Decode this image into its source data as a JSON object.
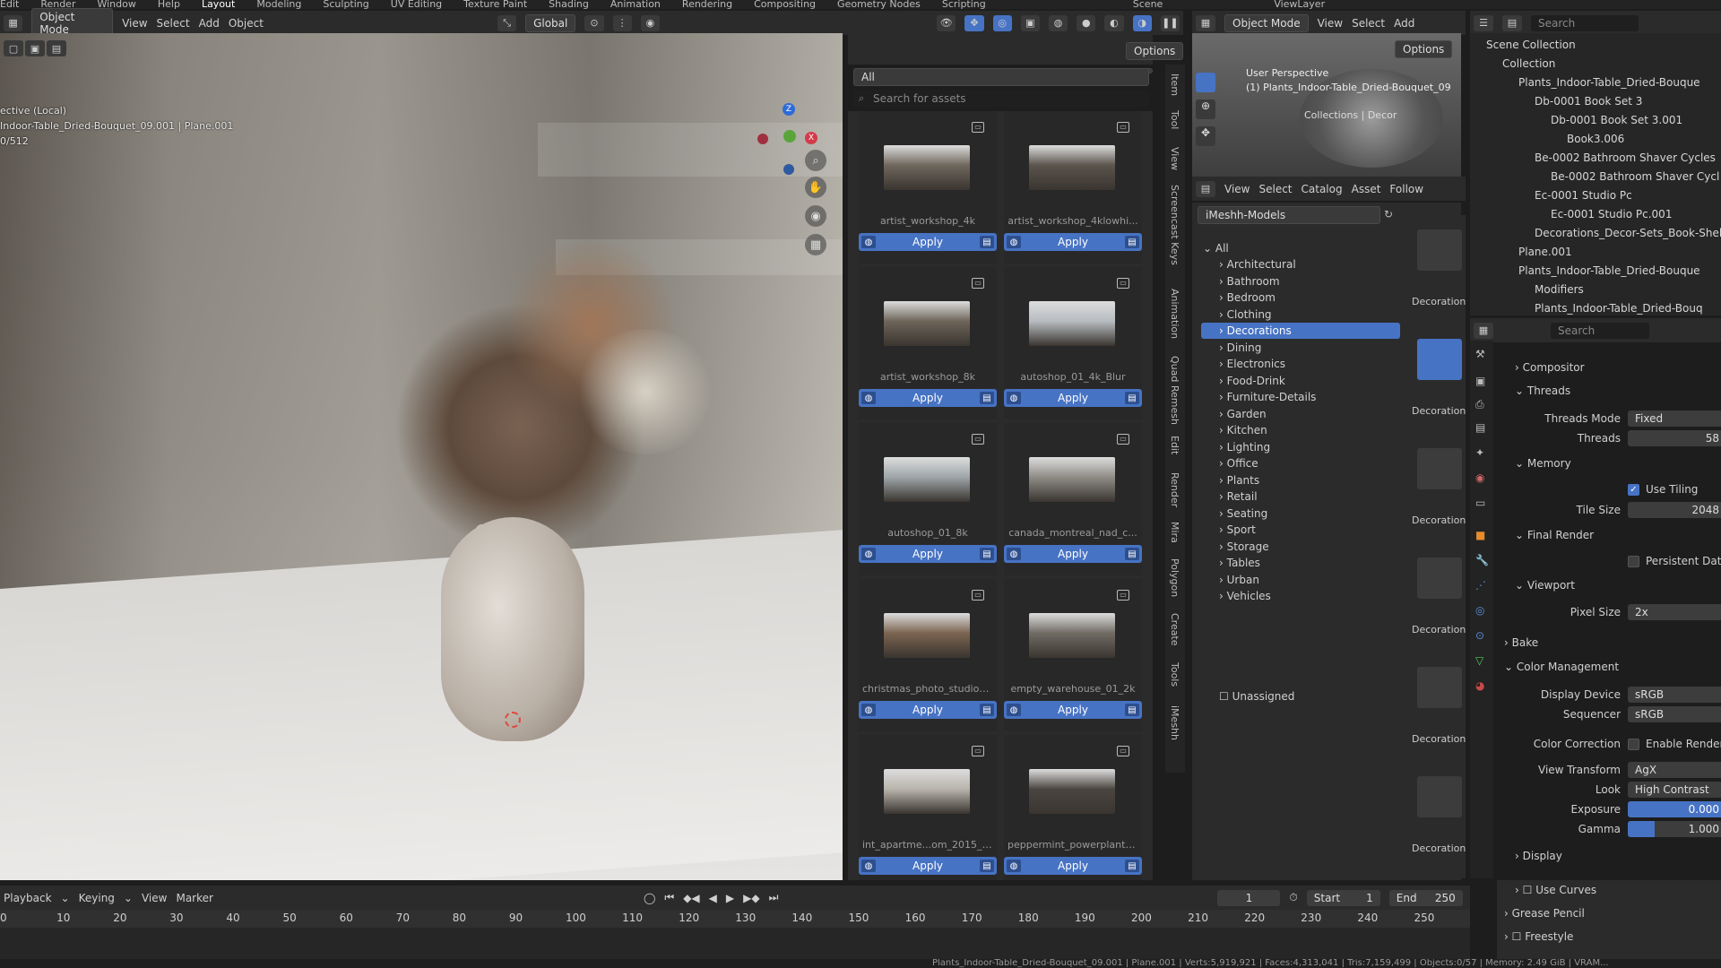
{
  "top_tabs": [
    "Edit",
    "Render",
    "Window",
    "Help",
    "Layout",
    "Modeling",
    "Sculpting",
    "UV Editing",
    "Texture Paint",
    "Shading",
    "Animation",
    "Rendering",
    "Compositing",
    "Geometry Nodes",
    "Scripting"
  ],
  "top_active": "Layout",
  "scene_label": "Scene",
  "viewlayer_label": "ViewLayer",
  "viewport_header": {
    "mode": "Object Mode",
    "menus": [
      "View",
      "Select",
      "Add",
      "Object"
    ],
    "orientation": "Global",
    "options": "Options"
  },
  "viewport_overlay": {
    "line1": "ective (Local)",
    "line2": "Indoor-Table_Dried-Bouquet_09.001 | Plane.001",
    "line3": "0/512"
  },
  "asset_browser": {
    "filter": "All",
    "search_placeholder": "Search for assets",
    "apply_label": "Apply",
    "items": [
      {
        "name": "artist_workshop_4k"
      },
      {
        "name": "artist_workshop_4klowhi..."
      },
      {
        "name": "artist_workshop_8k"
      },
      {
        "name": "autoshop_01_4k_Blur"
      },
      {
        "name": "autoshop_01_8k"
      },
      {
        "name": "canada_montreal_nad_c..."
      },
      {
        "name": "christmas_photo_studio_..."
      },
      {
        "name": "empty_warehouse_01_2k"
      },
      {
        "name": "int_apartme...om_2015_1k"
      },
      {
        "name": "peppermint_powerplant_..."
      }
    ],
    "thumb_colors": [
      "#6f675d",
      "#5a544c",
      "#6e655a",
      "#b7bcc0",
      "#9ea5a8",
      "#8f8c86",
      "#7b6450",
      "#706b63",
      "#b8b4ac",
      "#4a4540"
    ]
  },
  "vertical_tabs": [
    "Item",
    "Tool",
    "View",
    "Screencast Keys",
    "Animation",
    "Quad Remesh",
    "Edit",
    "Render",
    "Mira",
    "Polygon",
    "Create",
    "Tools",
    "iMeshh"
  ],
  "mini_viewport": {
    "mode": "Object Mode",
    "menus": [
      "View",
      "Select",
      "Add"
    ],
    "options": "Options",
    "title": "User Perspective",
    "subtitle": "(1) Plants_Indoor-Table_Dried-Bouquet_09",
    "collections_label": "Collections | Decor"
  },
  "catalog": {
    "menus": [
      "View",
      "Select",
      "Catalog",
      "Asset",
      "Follow"
    ],
    "library": "iMeshh-Models",
    "root": "All",
    "items": [
      "Architectural",
      "Bathroom",
      "Bedroom",
      "Clothing",
      "Decorations",
      "Dining",
      "Electronics",
      "Food-Drink",
      "Furniture-Details",
      "Garden",
      "Kitchen",
      "Lighting",
      "Office",
      "Plants",
      "Retail",
      "Seating",
      "Sport",
      "Storage",
      "Tables",
      "Urban",
      "Vehicles"
    ],
    "unassigned": "Unassigned",
    "selected": "Decorations",
    "thumb_label": "Decoration"
  },
  "outliner": {
    "search_placeholder": "Search",
    "items": [
      {
        "label": "Scene Collection",
        "indent": 0
      },
      {
        "label": "Collection",
        "indent": 1
      },
      {
        "label": "Plants_Indoor-Table_Dried-Bouque",
        "indent": 2
      },
      {
        "label": "Db-0001 Book Set 3",
        "indent": 3
      },
      {
        "label": "Db-0001 Book Set 3.001",
        "indent": 4
      },
      {
        "label": "Book3.006",
        "indent": 5
      },
      {
        "label": "Be-0002 Bathroom Shaver Cycles",
        "indent": 3
      },
      {
        "label": "Be-0002 Bathroom Shaver Cycl",
        "indent": 4
      },
      {
        "label": "Ec-0001 Studio Pc",
        "indent": 3
      },
      {
        "label": "Ec-0001 Studio Pc.001",
        "indent": 4
      },
      {
        "label": "Decorations_Decor-Sets_Book-Shel",
        "indent": 3
      },
      {
        "label": "Plane.001",
        "indent": 2
      },
      {
        "label": "Plants_Indoor-Table_Dried-Bouque",
        "indent": 2
      },
      {
        "label": "Modifiers",
        "indent": 3
      },
      {
        "label": "Plants_Indoor-Table_Dried-Bouq",
        "indent": 3
      }
    ]
  },
  "properties": {
    "search_placeholder": "Search",
    "compositor": "Compositor",
    "threads": "Threads",
    "threads_mode_label": "Threads Mode",
    "threads_mode": "Fixed",
    "threads_label": "Threads",
    "threads_value": "58",
    "memory": "Memory",
    "use_tiling": "Use Tiling",
    "tile_size_label": "Tile Size",
    "tile_size": "2048",
    "final_render": "Final Render",
    "persistent_data": "Persistent Data",
    "viewport": "Viewport",
    "pixel_size_label": "Pixel Size",
    "pixel_size": "2x",
    "bake": "Bake",
    "color_management": "Color Management",
    "display_device_label": "Display Device",
    "display_device": "sRGB",
    "sequencer_label": "Sequencer",
    "sequencer": "sRGB",
    "color_correction_label": "Color Correction",
    "enable_render": "Enable Render Ra",
    "view_transform_label": "View Transform",
    "view_transform": "AgX",
    "look_label": "Look",
    "look": "High Contrast",
    "exposure_label": "Exposure",
    "exposure": "0.000",
    "gamma_label": "Gamma",
    "gamma": "1.000",
    "display": "Display",
    "use_curves": "Use Curves",
    "grease_pencil": "Grease Pencil",
    "freestyle": "Freestyle"
  },
  "timeline": {
    "menus": [
      "Playback",
      "Keying",
      "View",
      "Marker"
    ],
    "current_frame": "1",
    "start_label": "Start",
    "start": "1",
    "end_label": "End",
    "end": "250",
    "ticks": [
      "0",
      "10",
      "20",
      "30",
      "40",
      "50",
      "60",
      "70",
      "80",
      "90",
      "100",
      "110",
      "120",
      "130",
      "140",
      "150",
      "160",
      "170",
      "180",
      "190",
      "200",
      "210",
      "220",
      "230",
      "240",
      "250"
    ]
  },
  "status_bar": "Plants_Indoor-Table_Dried-Bouquet_09.001 | Plane.001 | Verts:5,919,921 | Faces:4,313,041 | Tris:7,159,499 | Objects:0/57 | Memory: 2.49 GiB | VRAM..."
}
